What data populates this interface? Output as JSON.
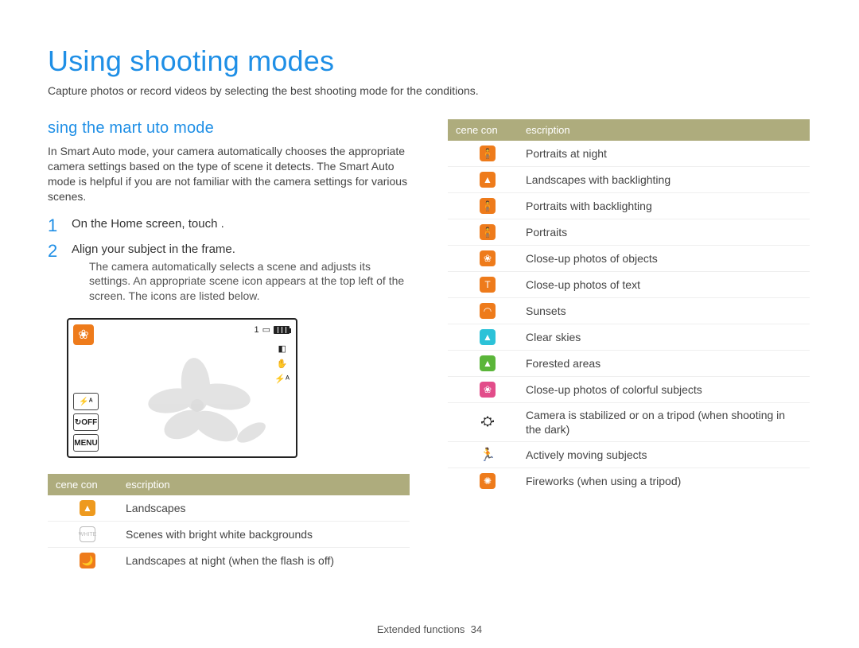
{
  "title": "Using shooting modes",
  "intro": "Capture photos or record videos by selecting the best shooting mode for the conditions.",
  "section_title": "sing the  mart  uto mode",
  "section_body": "In Smart Auto mode, your camera automatically chooses the appropriate camera settings based on the type of scene it detects. The Smart Auto mode is helpful if you are not familiar with the camera settings for various scenes.",
  "steps": [
    {
      "num": "1",
      "main": "On the Home screen, touch    .",
      "sub": ""
    },
    {
      "num": "2",
      "main": "Align your subject in the frame.",
      "sub": "The camera automatically selects a scene and adjusts its settings. An appropriate scene icon appears at the top left of the screen. The icons are listed below."
    }
  ],
  "camera_labels": {
    "count": "1",
    "flash": "⚡ᴬ",
    "timer": "↻OFF",
    "menu": "MENU",
    "flash_right": "⚡ᴬ"
  },
  "table_headers": {
    "col1": "cene  con",
    "col2": "escription"
  },
  "left_rows": [
    {
      "color": "#ee9a1f",
      "glyph": "▲",
      "desc": "Landscapes"
    },
    {
      "color": "#ffffff",
      "glyph": "",
      "border": true,
      "desc": "Scenes with bright white backgrounds"
    },
    {
      "color": "#ee7b1b",
      "glyph": "🌙",
      "desc": "Landscapes at night (when the flash is off)"
    }
  ],
  "right_rows": [
    {
      "color": "#ee7b1b",
      "glyph": "🧍",
      "desc": "Portraits at night"
    },
    {
      "color": "#ee7b1b",
      "glyph": "▲",
      "desc": "Landscapes with backlighting"
    },
    {
      "color": "#ee7b1b",
      "glyph": "🧍",
      "desc": "Portraits with backlighting"
    },
    {
      "color": "#ee7b1b",
      "glyph": "🧍",
      "desc": "Portraits"
    },
    {
      "color": "#ee7b1b",
      "glyph": "❀",
      "desc": "Close-up photos of objects"
    },
    {
      "color": "#ee7b1b",
      "glyph": "T",
      "desc": "Close-up photos of text"
    },
    {
      "color": "#ee7b1b",
      "glyph": "◠",
      "desc": "Sunsets"
    },
    {
      "color": "#2cc2d8",
      "glyph": "▲",
      "desc": "Clear skies"
    },
    {
      "color": "#5bb63a",
      "glyph": "▲",
      "desc": "Forested areas"
    },
    {
      "color": "#e24d8a",
      "glyph": "❀",
      "desc": "Close-up photos of colorful subjects"
    },
    {
      "stick": true,
      "glyph": "⛮",
      "desc": "Camera is stabilized or on a tripod (when shooting in the dark)"
    },
    {
      "stick": true,
      "glyph": "🏃",
      "desc": "Actively moving subjects"
    },
    {
      "color": "#ee7b1b",
      "glyph": "✺",
      "desc": "Fireworks (when using a tripod)"
    }
  ],
  "footer_section": "Extended functions",
  "footer_page": "34"
}
